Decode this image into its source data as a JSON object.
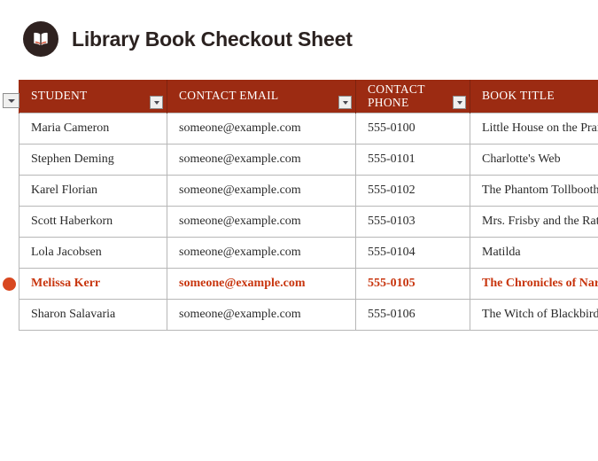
{
  "document": {
    "title": "Library Book Checkout Sheet",
    "icon": "open-book-icon"
  },
  "colors": {
    "header_background": "#9c2b12",
    "header_text": "#ffffff",
    "title_text": "#2b2220",
    "icon_circle": "#2f2220",
    "flagged_text": "#c8360f",
    "marker_dot": "#d8471f",
    "cell_border": "#b7b7b7"
  },
  "table": {
    "columns": [
      {
        "label": "STUDENT",
        "key": "student"
      },
      {
        "label": "CONTACT EMAIL",
        "key": "email"
      },
      {
        "label": "CONTACT PHONE",
        "key": "phone"
      },
      {
        "label": "BOOK TITLE",
        "key": "book"
      }
    ],
    "rows": [
      {
        "student": "Maria Cameron",
        "email": "someone@example.com",
        "phone": "555-0100",
        "book": "Little House on the Prairie",
        "flagged": false
      },
      {
        "student": "Stephen Deming",
        "email": "someone@example.com",
        "phone": "555-0101",
        "book": "Charlotte's Web",
        "flagged": false
      },
      {
        "student": "Karel Florian",
        "email": "someone@example.com",
        "phone": "555-0102",
        "book": "The Phantom Tollbooth",
        "flagged": false
      },
      {
        "student": "Scott Haberkorn",
        "email": "someone@example.com",
        "phone": "555-0103",
        "book": "Mrs. Frisby and the Rats of NIMH",
        "flagged": false
      },
      {
        "student": "Lola Jacobsen",
        "email": "someone@example.com",
        "phone": "555-0104",
        "book": "Matilda",
        "flagged": false
      },
      {
        "student": "Melissa Kerr",
        "email": "someone@example.com",
        "phone": "555-0105",
        "book": "The Chronicles of Narnia",
        "flagged": true
      },
      {
        "student": "Sharon Salavaria",
        "email": "someone@example.com",
        "phone": "555-0106",
        "book": "The Witch of Blackbird Pond",
        "flagged": false
      }
    ]
  }
}
